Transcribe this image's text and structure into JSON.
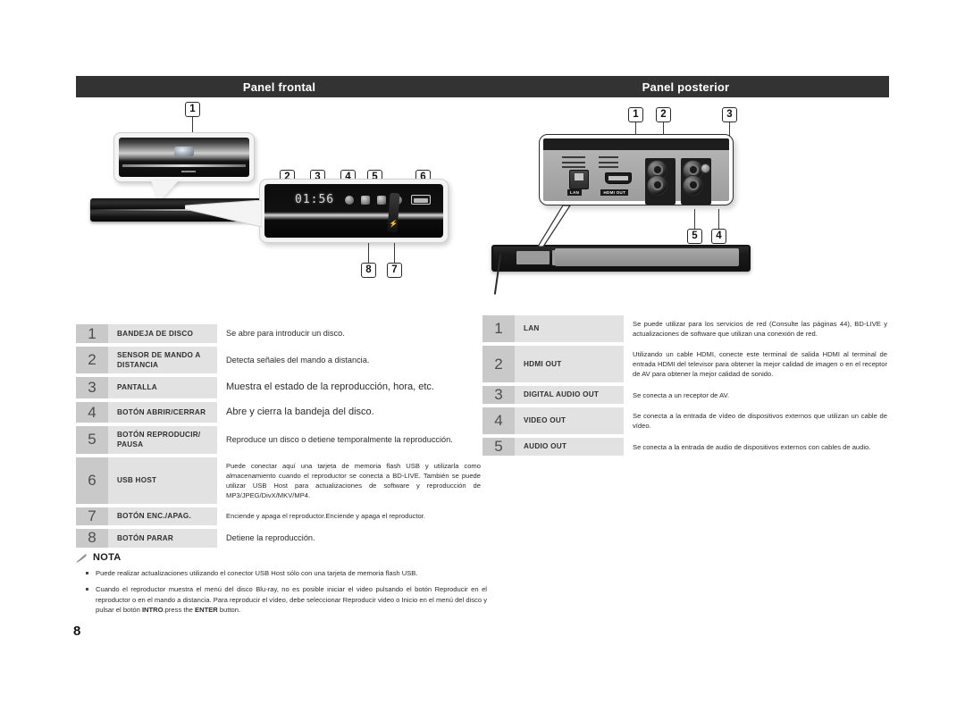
{
  "document": {
    "page_number": "8"
  },
  "sections": [
    {
      "id": "front",
      "title": "Panel frontal",
      "illustration": {
        "display_value": "01:56",
        "callouts": [
          "1",
          "2",
          "3",
          "4",
          "5",
          "6",
          "7",
          "8"
        ]
      },
      "rows": [
        {
          "num": "1",
          "name": "BANDEJA DE DISCO",
          "desc": "Se abre para introducir un disco.",
          "size": "md"
        },
        {
          "num": "2",
          "name": "SENSOR DE MANDO A DISTANCIA",
          "desc": "Detecta señales del mando a distancia.",
          "size": "md"
        },
        {
          "num": "3",
          "name": "PANTALLA",
          "desc": "Muestra el estado de la reproducción, hora, etc.",
          "size": "lg"
        },
        {
          "num": "4",
          "name": "BOTÓN ABRIR/CERRAR",
          "desc": "Abre y cierra la bandeja del disco.",
          "size": "lg"
        },
        {
          "num": "5",
          "name": "BOTÓN REPRODUCIR/ PAUSA",
          "desc": "Reproduce un disco o detiene temporalmente la reproducción.",
          "size": "md"
        },
        {
          "num": "6",
          "name": "USB HOST",
          "desc": "Puede conectar aquí una tarjeta de memoria flash USB y utilizarla como almacenamiento cuando el reproductor se conecta a BD-LIVE. También se puede utilizar USB Host para actualizaciones de software y reproducción de MP3/JPEG/DivX/MKV/MP4.",
          "size": "sm"
        },
        {
          "num": "7",
          "name": "BOTÓN ENC./APAG.",
          "desc": "Enciende y apaga el reproductor.Enciende y apaga el reproductor.",
          "size": "sm"
        },
        {
          "num": "8",
          "name": "BOTÓN PARAR",
          "desc": "Detiene la reproducción.",
          "size": "md"
        }
      ]
    },
    {
      "id": "rear",
      "title": "Panel posterior",
      "illustration": {
        "jack_labels": [
          "LAN",
          "HDMI OUT"
        ],
        "callouts": [
          "1",
          "2",
          "3",
          "4",
          "5"
        ]
      },
      "rows": [
        {
          "num": "1",
          "name": "LAN",
          "desc": "Se puede utilizar para los servicios de red (Consulte las páginas 44), BD-LIVE y actualizaciones de software que utilizan una conexión de red.",
          "size": "sm"
        },
        {
          "num": "2",
          "name": "HDMI OUT",
          "desc": "Utilizando un cable HDMI, conecte este terminal de salida HDMI al terminal de entrada HDMI del televisor para obtener la mejor calidad de imagen o en el receptor de AV para obtener la mejor calidad de sonido.",
          "size": "sm"
        },
        {
          "num": "3",
          "name": "DIGITAL AUDIO OUT",
          "desc": "Se conecta a un receptor de AV.",
          "size": "sm"
        },
        {
          "num": "4",
          "name": "VIDEO OUT",
          "desc": "Se conecta a la entrada de vídeo de dispositivos externos que utilizan un cable de vídeo.",
          "size": "sm"
        },
        {
          "num": "5",
          "name": "AUDIO OUT",
          "desc": "Se conecta a la entrada de audio de dispositivos externos con cables de audio.",
          "size": "sm"
        }
      ]
    }
  ],
  "note": {
    "icon": "pencil-icon",
    "title": "NOTA",
    "items": [
      {
        "text_before": "Puede realizar actualizaciones utilizando el conector USB Host sólo con una tarjeta de memoria flash USB.",
        "bold1": "",
        "text_mid": "",
        "bold2": "",
        "text_after": ""
      },
      {
        "text_before": "Cuando el reproductor muestra el menú del disco Blu-ray, no es posible iniciar el video pulsando el botón Reproducir en el reproductor o en el mando a distancia. Para reproducir el vídeo, debe seleccionar Reproducir video o Inicio en el menú del disco y pulsar el botón ",
        "bold1": "INTRO",
        "text_mid": ".press the ",
        "bold2": "ENTER",
        "text_after": " button."
      }
    ]
  },
  "colors": {
    "header_bar": "#333333",
    "cell_num_bg": "#c9c9c9",
    "cell_name_bg": "#e2e2e2",
    "text": "#2b2b2b"
  }
}
